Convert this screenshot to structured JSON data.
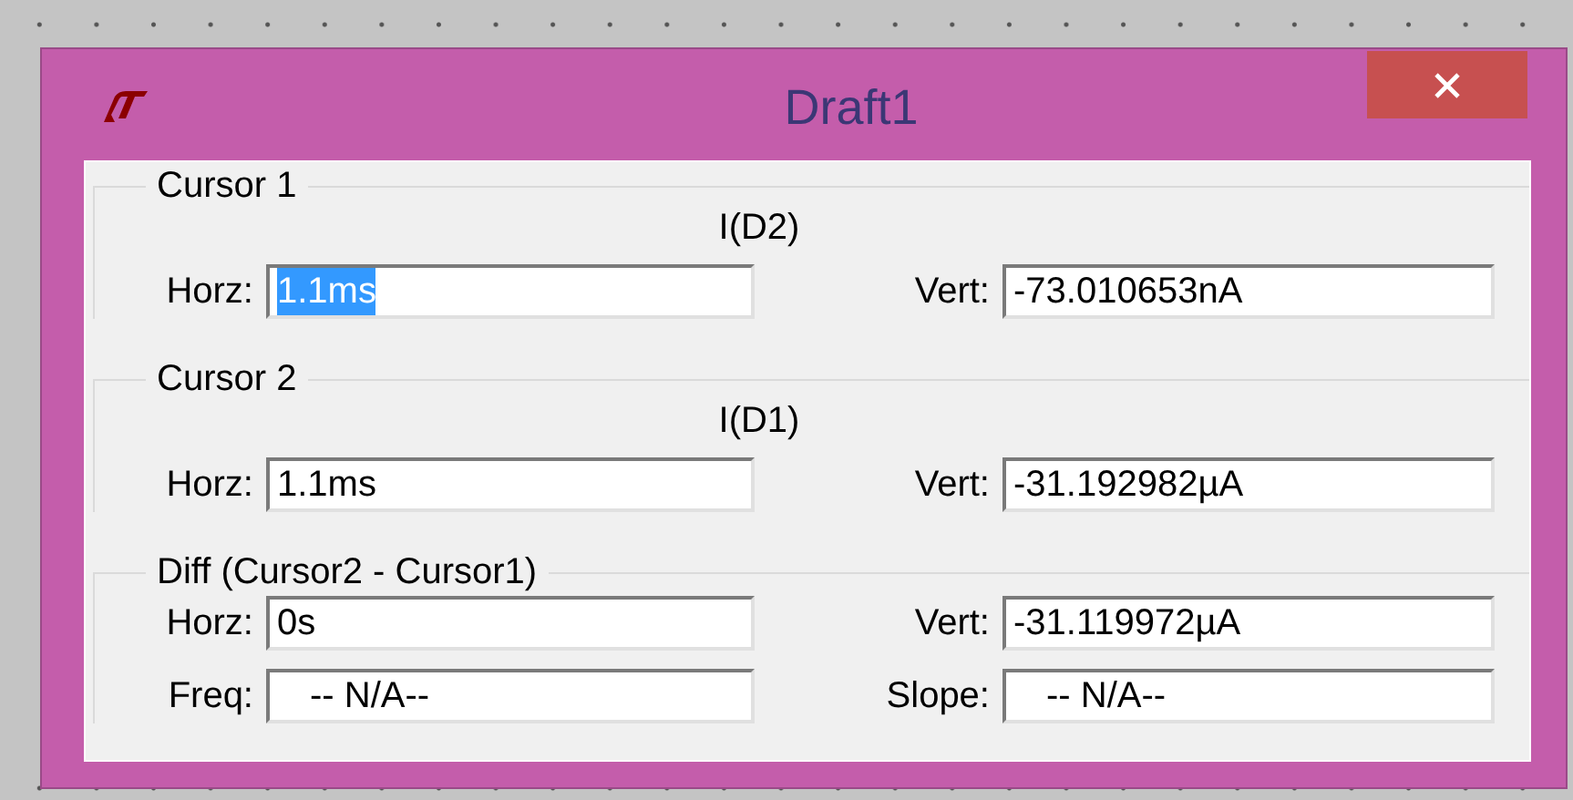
{
  "window": {
    "title": "Draft1"
  },
  "groups": [
    {
      "title": "Cursor 1",
      "trace": "I(D2)",
      "fields": [
        {
          "label": "Horz:",
          "value": "1.1ms",
          "selected": true
        },
        {
          "label": "Vert:",
          "value": "-73.010653nA",
          "selected": false
        }
      ]
    },
    {
      "title": "Cursor 2",
      "trace": "I(D1)",
      "fields": [
        {
          "label": "Horz:",
          "value": "1.1ms",
          "selected": false
        },
        {
          "label": "Vert:",
          "value": "-31.192982µA",
          "selected": false
        }
      ]
    },
    {
      "title": "Diff (Cursor2 - Cursor1)",
      "fields": [
        {
          "label": "Horz:",
          "value": "0s",
          "selected": false
        },
        {
          "label": "Vert:",
          "value": "-31.119972µA",
          "selected": false
        },
        {
          "label": "Freq:",
          "value": "-- N/A--",
          "selected": false
        },
        {
          "label": "Slope:",
          "value": "-- N/A--",
          "selected": false
        }
      ]
    }
  ]
}
